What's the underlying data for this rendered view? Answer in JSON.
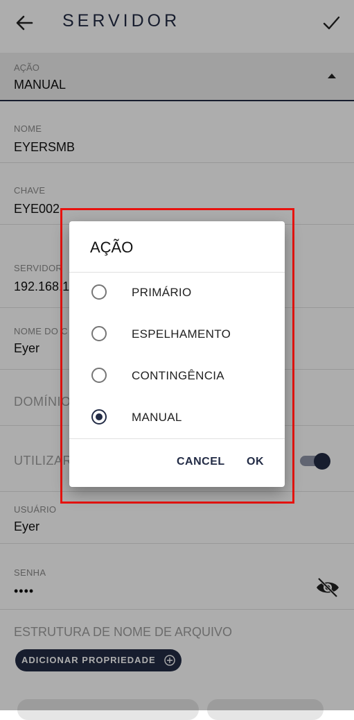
{
  "appbar": {
    "title": "SERVIDOR"
  },
  "fields": {
    "acao": {
      "label": "AÇÃO",
      "value": "MANUAL"
    },
    "nome": {
      "label": "NOME",
      "value": "EYERSMB"
    },
    "chave": {
      "label": "CHAVE",
      "value": "EYE002"
    },
    "servidor": {
      "label": "SERVIDOR",
      "value": "192.168.1"
    },
    "nome_do": {
      "label": "NOME DO C",
      "value": "Eyer"
    },
    "dominio": {
      "label": "DOMÍNIO"
    },
    "utilizar": {
      "label": "UTILIZAR",
      "toggle_on": true
    },
    "usuario": {
      "label": "USUÁRIO",
      "value": "Eyer"
    },
    "senha": {
      "label": "SENHA",
      "value": "••••"
    },
    "estrutura": {
      "label": "ESTRUTURA DE NOME DE ARQUIVO"
    }
  },
  "chip": {
    "label": "ADICIONAR PROPRIEDADE"
  },
  "dialog": {
    "title": "AÇÃO",
    "options": [
      {
        "label": "PRIMÁRIO",
        "selected": false
      },
      {
        "label": "ESPELHAMENTO",
        "selected": false
      },
      {
        "label": "CONTINGÊNCIA",
        "selected": false
      },
      {
        "label": "MANUAL",
        "selected": true
      }
    ],
    "cancel_label": "CANCEL",
    "ok_label": "OK"
  },
  "colors": {
    "primary": "#222b45",
    "highlight": "#e8130f"
  }
}
